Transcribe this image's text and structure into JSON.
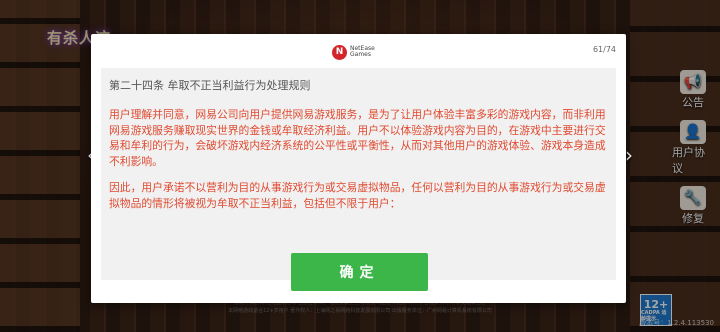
{
  "game": {
    "logo_text": "有杀人迹",
    "version_label": "版本号：1.2.4.113530"
  },
  "side_tools": [
    {
      "icon": "megaphone-icon",
      "glyph": "📢",
      "label": "公告"
    },
    {
      "icon": "user-agreement-icon",
      "glyph": "👤",
      "label": "用户协议"
    },
    {
      "icon": "wrench-icon",
      "glyph": "🔧",
      "label": "修复"
    }
  ],
  "footer": {
    "line1": "抵制不良游戏 拒绝盗版游戏 注意自我保护 谨防受骗上当 适度游戏益脑 沉迷游戏伤身 合理安排时间 享受健康生活",
    "line2": "本网络游戏适合12+岁用户 著作权人：上海网之易网络科技发展有限公司 出版服务单位：广州网易计算机系统有限公司",
    "age_rating": "12+",
    "age_rating_sub": "CADPA 适龄提示"
  },
  "dialog": {
    "brand_mark": "N",
    "brand_line1": "NetEase",
    "brand_line2": "Games",
    "page_indicator": "61/74",
    "article_title": "第二十四条 牟取不正当利益行为处理规则",
    "paragraphs": [
      "用户理解并同意，网易公司向用户提供网易游戏服务，是为了让用户体验丰富多彩的游戏内容，而非利用网易游戏服务赚取现实世界的金钱或牟取经济利益。用户不以体验游戏内容为目的，在游戏中主要进行交易和牟利的行为，会破坏游戏内经济系统的公平性或平衡性，从而对其他用户的游戏体验、游戏本身造成不利影响。",
      "因此，用户承诺不以营利为目的从事游戏行为或交易虚拟物品，任何以营利为目的从事游戏行为或交易虚拟物品的情形将被视为牟取不正当利益，包括但不限于用户："
    ],
    "confirm_label": "确定",
    "prev_glyph": "‹",
    "next_glyph": "›"
  },
  "colors": {
    "accent_green": "#3cb549",
    "terms_red": "#e04a30",
    "brand_red": "#d3242a"
  }
}
